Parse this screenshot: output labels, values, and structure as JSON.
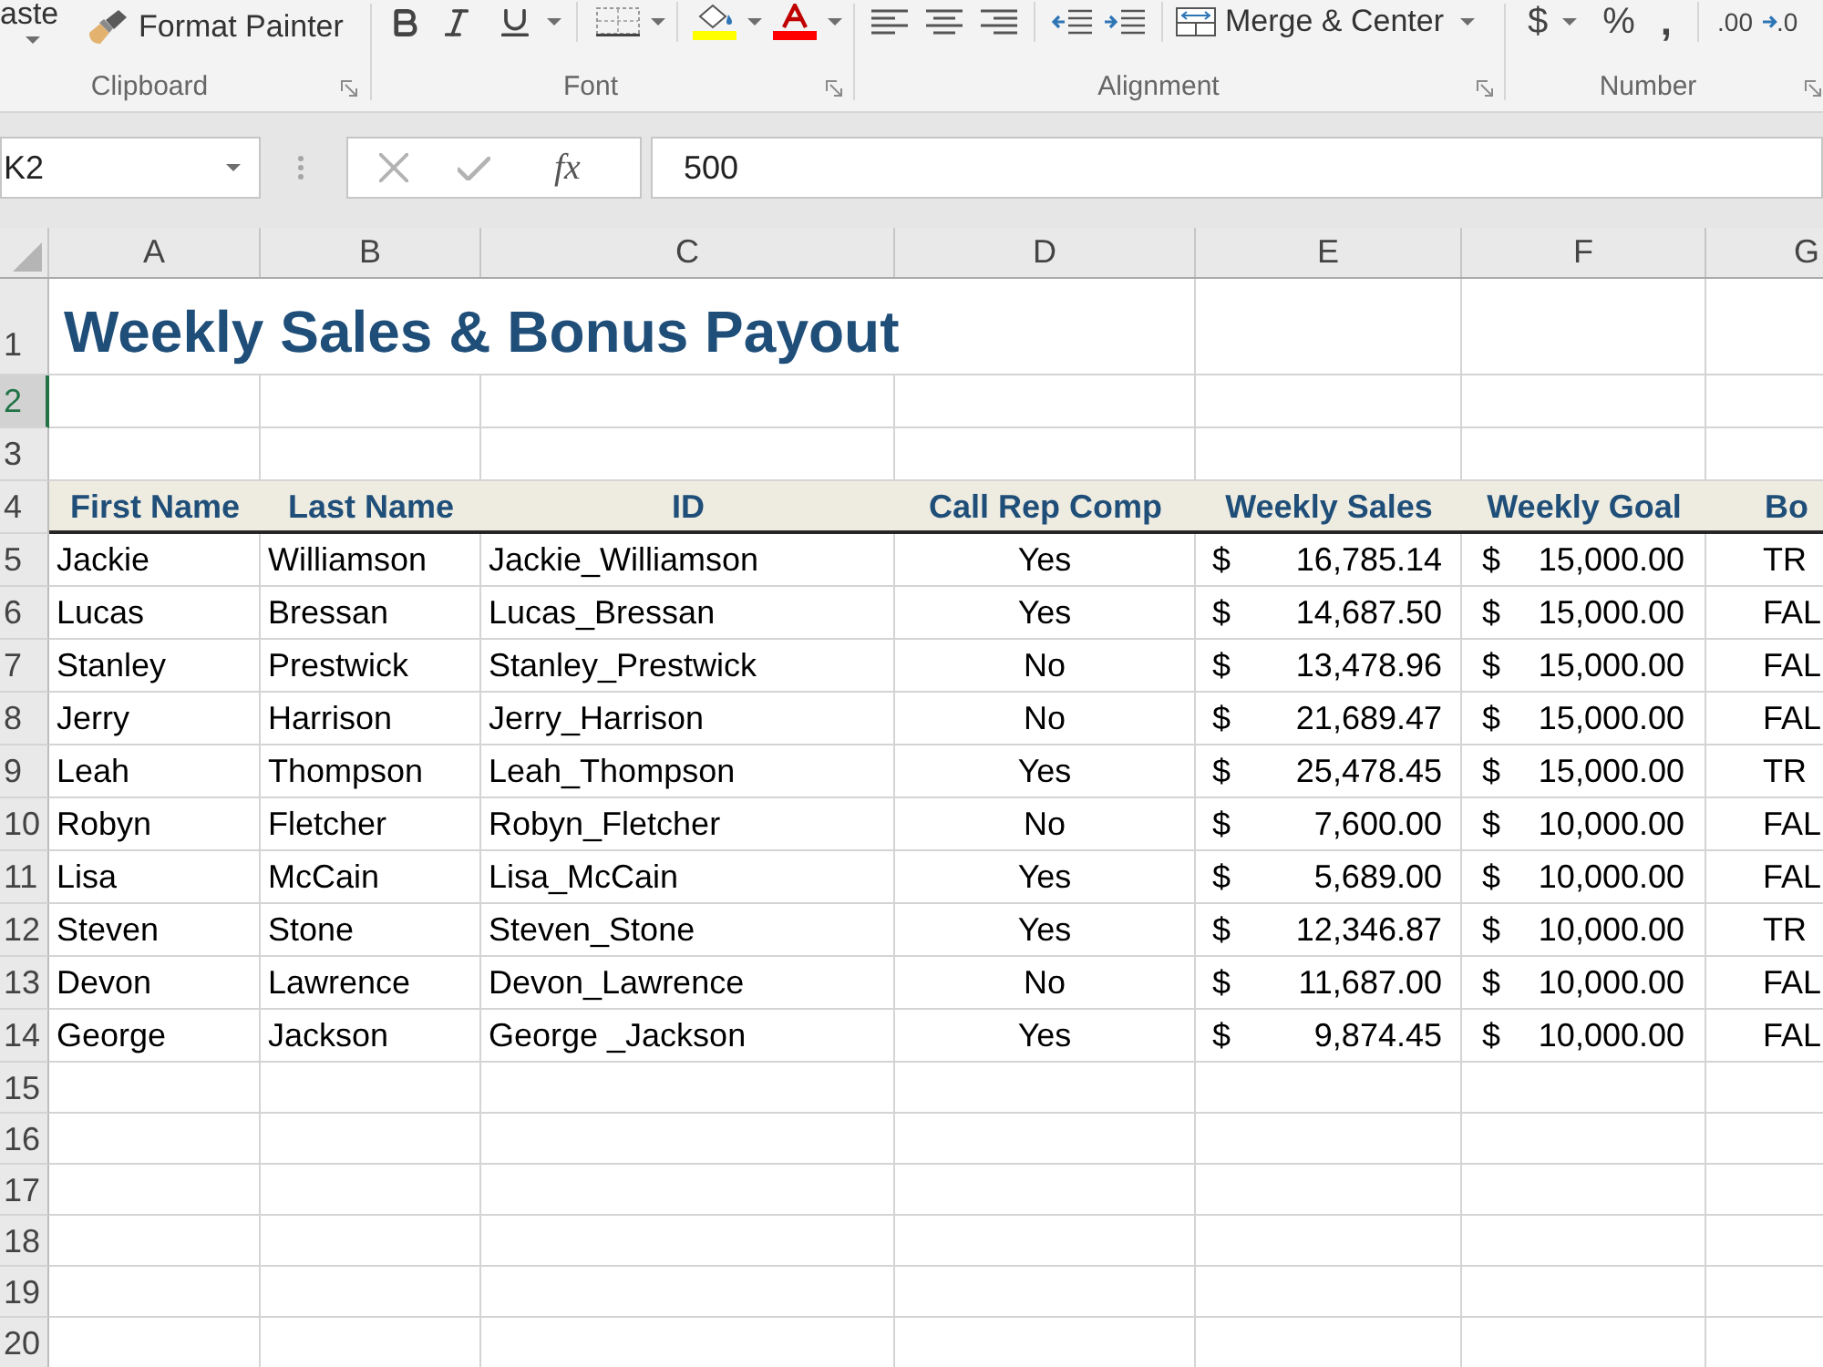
{
  "ribbon": {
    "groups": [
      {
        "kind": "clipboard",
        "label": "Clipboard",
        "paste": "aste",
        "format_painter": "Format Painter"
      },
      {
        "kind": "font",
        "label": "Font"
      },
      {
        "kind": "alignment",
        "label": "Alignment",
        "merge": "Merge & Center"
      },
      {
        "kind": "number",
        "label": "Number",
        "currency": "$",
        "percent": "%",
        "comma": ",",
        "decimal": ".00",
        "decimal_next": ".0"
      }
    ]
  },
  "formula_bar": {
    "name_box": "K2",
    "function_label": "fx",
    "formula": "500"
  },
  "sheet": {
    "columns": [
      "A",
      "B",
      "C",
      "D",
      "E",
      "F",
      "G"
    ],
    "row_headers": [
      {
        "label": "1",
        "selected": false
      },
      {
        "label": "2",
        "selected": true
      },
      {
        "label": "3",
        "selected": false
      },
      {
        "label": "4",
        "selected": false
      },
      {
        "label": "5",
        "selected": false
      },
      {
        "label": "6",
        "selected": false
      },
      {
        "label": "7",
        "selected": false
      },
      {
        "label": "8",
        "selected": false
      },
      {
        "label": "9",
        "selected": false
      },
      {
        "label": "10",
        "selected": false
      },
      {
        "label": "11",
        "selected": false
      },
      {
        "label": "12",
        "selected": false
      },
      {
        "label": "13",
        "selected": false
      },
      {
        "label": "14",
        "selected": false
      },
      {
        "label": "15",
        "selected": false
      },
      {
        "label": "16",
        "selected": false
      },
      {
        "label": "17",
        "selected": false
      },
      {
        "label": "18",
        "selected": false
      },
      {
        "label": "19",
        "selected": false
      },
      {
        "label": "20",
        "selected": false
      }
    ],
    "title": "Weekly Sales & Bonus Payout",
    "headers": [
      "First Name",
      "Last Name",
      "ID",
      "Call Rep Comp",
      "Weekly Sales",
      "Weekly Goal",
      "Bo"
    ],
    "rows": [
      {
        "first_name": "Jackie",
        "last_name": "Williamson",
        "id": "Jackie_Williamson",
        "call_rep_comp": "Yes",
        "sales_currency": "$",
        "weekly_sales": "16,785.14",
        "goal_currency": "$",
        "weekly_goal": "15,000.00",
        "bonus": "TR"
      },
      {
        "first_name": "Lucas",
        "last_name": "Bressan",
        "id": "Lucas_Bressan",
        "call_rep_comp": "Yes",
        "sales_currency": "$",
        "weekly_sales": "14,687.50",
        "goal_currency": "$",
        "weekly_goal": "15,000.00",
        "bonus": "FAL"
      },
      {
        "first_name": "Stanley",
        "last_name": "Prestwick",
        "id": "Stanley_Prestwick",
        "call_rep_comp": "No",
        "sales_currency": "$",
        "weekly_sales": "13,478.96",
        "goal_currency": "$",
        "weekly_goal": "15,000.00",
        "bonus": "FAL"
      },
      {
        "first_name": "Jerry",
        "last_name": "Harrison",
        "id": "Jerry_Harrison",
        "call_rep_comp": "No",
        "sales_currency": "$",
        "weekly_sales": "21,689.47",
        "goal_currency": "$",
        "weekly_goal": "15,000.00",
        "bonus": "FAL"
      },
      {
        "first_name": "Leah",
        "last_name": "Thompson",
        "id": "Leah_Thompson",
        "call_rep_comp": "Yes",
        "sales_currency": "$",
        "weekly_sales": "25,478.45",
        "goal_currency": "$",
        "weekly_goal": "15,000.00",
        "bonus": "TR"
      },
      {
        "first_name": "Robyn",
        "last_name": "Fletcher",
        "id": "Robyn_Fletcher",
        "call_rep_comp": "No",
        "sales_currency": "$",
        "weekly_sales": "7,600.00",
        "goal_currency": "$",
        "weekly_goal": "10,000.00",
        "bonus": "FAL"
      },
      {
        "first_name": "Lisa",
        "last_name": "McCain",
        "id": "Lisa_McCain",
        "call_rep_comp": "Yes",
        "sales_currency": "$",
        "weekly_sales": "5,689.00",
        "goal_currency": "$",
        "weekly_goal": "10,000.00",
        "bonus": "FAL"
      },
      {
        "first_name": "Steven",
        "last_name": "Stone",
        "id": "Steven_Stone",
        "call_rep_comp": "Yes",
        "sales_currency": "$",
        "weekly_sales": "12,346.87",
        "goal_currency": "$",
        "weekly_goal": "10,000.00",
        "bonus": "TR"
      },
      {
        "first_name": "Devon",
        "last_name": "Lawrence",
        "id": "Devon_Lawrence",
        "call_rep_comp": "No",
        "sales_currency": "$",
        "weekly_sales": "11,687.00",
        "goal_currency": "$",
        "weekly_goal": "10,000.00",
        "bonus": "FAL"
      },
      {
        "first_name": "George",
        "last_name": "Jackson",
        "id": "George _Jackson",
        "call_rep_comp": "Yes",
        "sales_currency": "$",
        "weekly_sales": "9,874.45",
        "goal_currency": "$",
        "weekly_goal": "10,000.00",
        "bonus": "FAL"
      }
    ]
  }
}
